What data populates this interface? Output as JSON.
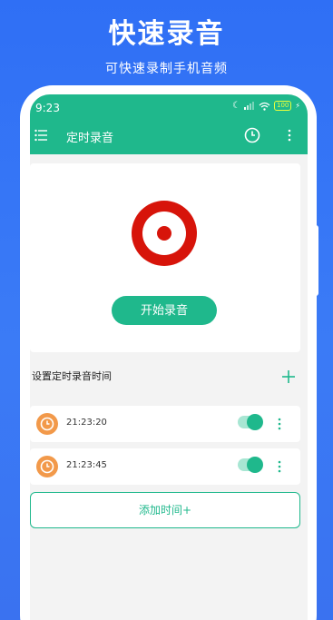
{
  "hero": {
    "title": "快速录音",
    "subtitle": "可快速录制手机音频"
  },
  "status_bar": {
    "time": "9:23",
    "battery": "100"
  },
  "app_bar": {
    "title": "定时录音",
    "icons": [
      "menu-icon",
      "clock-icon",
      "more-vertical-icon"
    ]
  },
  "record": {
    "start_label": "开始录音"
  },
  "schedule": {
    "section_title": "设置定时录音时间",
    "times": [
      {
        "time": "21:23:20",
        "enabled": true
      },
      {
        "time": "21:23:45",
        "enabled": true
      }
    ],
    "add_label": "添加时间+"
  },
  "colors": {
    "background": "#3b7bf6",
    "accent": "#1fb88c",
    "record_red": "#d7140a",
    "alarm_orange": "#f2994a"
  }
}
